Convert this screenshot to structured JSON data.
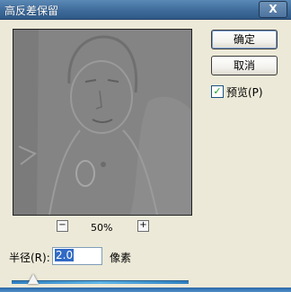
{
  "window": {
    "title": "高反差保留",
    "close_label": "X"
  },
  "buttons": {
    "ok_label": "确定",
    "cancel_label": "取消"
  },
  "preview_option": {
    "label": "预览(P)",
    "checked": true,
    "check_glyph": "✓"
  },
  "zoom": {
    "minus_label": "−",
    "plus_label": "+",
    "value_text": "50%"
  },
  "radius": {
    "label": "半径(R):",
    "value": "2.0",
    "unit": "像素",
    "slider_fraction": 0.06
  },
  "colors": {
    "title_bar": "#3e6b9a",
    "dialog_bg": "#ece9d8",
    "preview_gray": "#838383",
    "slider_accent": "#3b8fd0"
  },
  "icons": {
    "close": "close-icon",
    "check": "check-icon",
    "zoom_out": "minus-icon",
    "zoom_in": "plus-icon",
    "slider_thumb": "triangle-icon"
  }
}
